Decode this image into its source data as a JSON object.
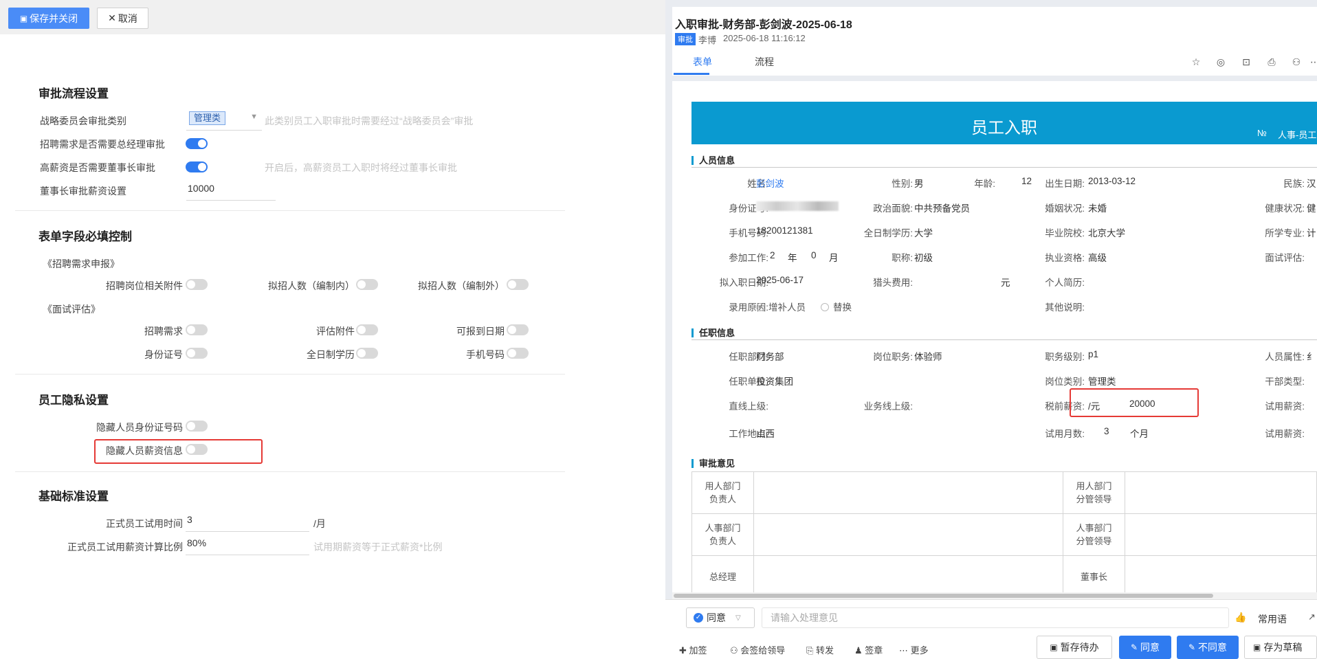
{
  "toolbar": {
    "save_close": "保存并关闭",
    "cancel": "取消"
  },
  "approval_settings": {
    "title": "审批流程设置",
    "strategy_label": "战略委员会审批类别",
    "strategy_value": "管理类",
    "strategy_hint": "此类别员工入职审批时需要经过“战略委员会”审批",
    "gm_label": "招聘需求是否需要总经理审批",
    "gm_on": true,
    "chairman_label": "高薪资是否需要董事长审批",
    "chairman_on": true,
    "chairman_hint": "开启后，高薪资员工入职时将经过董事长审批",
    "salary_label": "董事长审批薪资设置",
    "salary_value": "10000"
  },
  "required_fields": {
    "title": "表单字段必填控制",
    "group1": "《招聘需求申报》",
    "g1_items": [
      "招聘岗位相关附件",
      "拟招人数（编制内）",
      "拟招人数（编制外）"
    ],
    "group2": "《面试评估》",
    "g2_row1": [
      "招聘需求",
      "评估附件",
      "可报到日期"
    ],
    "g2_row2": [
      "身份证号",
      "全日制学历",
      "手机号码"
    ]
  },
  "privacy": {
    "title": "员工隐私设置",
    "hide_id": "隐藏人员身份证号码",
    "hide_salary": "隐藏人员薪资信息"
  },
  "basic": {
    "title": "基础标准设置",
    "probation_label": "正式员工试用时间",
    "probation_value": "3",
    "probation_unit": "/月",
    "ratio_label": "正式员工试用薪资计算比例",
    "ratio_value": "80%",
    "ratio_hint": "试用期薪资等于正式薪资*比例"
  },
  "doc": {
    "title": "入职审批-财务部-彭剑波-2025-06-18",
    "badge": "审批",
    "author": "李博",
    "time": "2025-06-18 11:16:12",
    "tabs": [
      "表单",
      "流程"
    ]
  },
  "form": {
    "banner": "员工入职",
    "no_label": "№",
    "no_value": "人事-员工",
    "personal_title": "人员信息",
    "name_l": "姓名:",
    "name_v": "彭剑波",
    "gender_l": "性别:",
    "gender_v": "男",
    "age_l": "年龄:",
    "age_v": "12",
    "birth_l": "出生日期:",
    "birth_v": "2013-03-12",
    "ethnic_l": "民族:",
    "ethnic_v": "汉",
    "idno_l": "身份证号:",
    "political_l": "政治面貌:",
    "political_v": "中共预备党员",
    "marital_l": "婚姻状况:",
    "marital_v": "未婚",
    "health_l": "健康状况:",
    "health_v": "健",
    "phone_l": "手机号码:",
    "phone_v": "18200121381",
    "edu_l": "全日制学历:",
    "edu_v": "大学",
    "school_l": "毕业院校:",
    "school_v": "北京大学",
    "major_l": "所学专业:",
    "major_v": "计",
    "work_l": "参加工作:",
    "work_year": "2",
    "year_unit": "年",
    "work_month": "0",
    "month_unit": "月",
    "title_l": "职称:",
    "title_v": "初级",
    "qual_l": "执业资格:",
    "qual_v": "高级",
    "interview_l": "面试评估:",
    "join_l": "拟入职日期:",
    "join_v": "2025-06-17",
    "headhunt_l": "猎头费用:",
    "headhunt_unit": "元",
    "resume_l": "个人简历:",
    "reason_l": "录用原因:",
    "reason_opt1": "增补人员",
    "reason_opt2": "替换",
    "other_l": "其他说明:",
    "job_title": "任职信息",
    "dept_l": "任职部门:",
    "dept_v": "财务部",
    "post_l": "岗位职务:",
    "post_v": "体验师",
    "level_l": "职务级别:",
    "level_v": "p1",
    "attr_l": "人员属性:",
    "attr_v": "纟",
    "unit_l": "任职单位:",
    "unit_v": "投资集团",
    "ptype_l": "岗位类别:",
    "ptype_v": "管理类",
    "cadre_l": "干部类型:",
    "boss_l": "直线上级:",
    "bizboss_l": "业务线上级:",
    "salary_l": "税前薪资:",
    "salary_unit": "/元",
    "salary_v": "20000",
    "prob_salary_l": "试用薪资:",
    "loc_l": "工作地点:",
    "loc_v": "山西",
    "prob_months_l": "试用月数:",
    "prob_months_v": "3",
    "prob_months_unit": "个月",
    "prob_salary2_l": "试用薪资:",
    "opinion_title": "审批意见",
    "op_rows": [
      [
        "用人部门\n负责人",
        "用人部门\n分管领导"
      ],
      [
        "人事部门\n负责人",
        "人事部门\n分管领导"
      ],
      [
        "总经理",
        "董事长"
      ]
    ]
  },
  "bottom": {
    "agree": "同意",
    "placeholder": "请输入处理意见",
    "common": "常用语",
    "actions": [
      "加签",
      "会签给领导",
      "转发",
      "签章",
      "更多"
    ],
    "save_pending": "暂存待办",
    "btn_agree": "同意",
    "btn_disagree": "不同意",
    "save_draft": "存为草稿"
  }
}
